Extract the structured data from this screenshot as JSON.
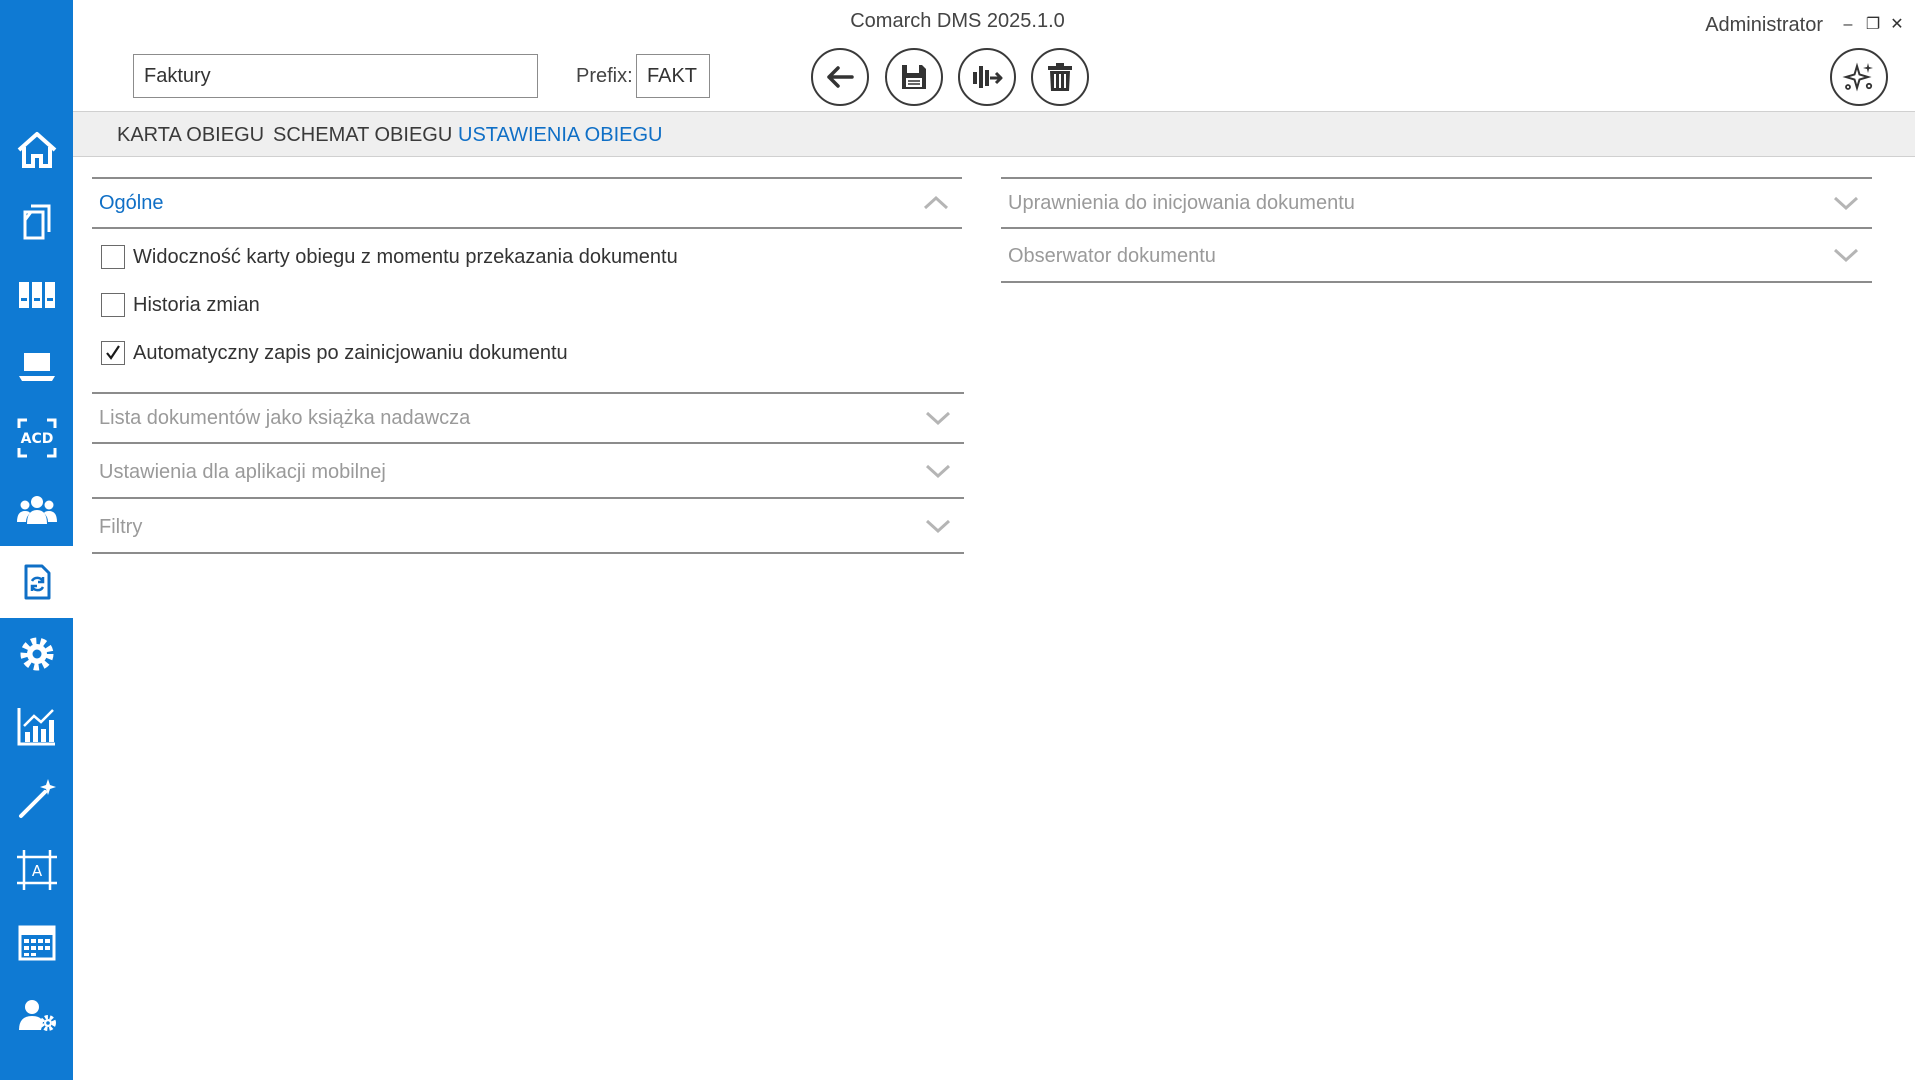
{
  "app": {
    "title": "Comarch DMS 2025.1.0",
    "user": "Administrator"
  },
  "window": {
    "minimize": "–",
    "restore": "❐",
    "close": "✕"
  },
  "header": {
    "name_value": "Faktury",
    "prefix_label": "Prefix:",
    "prefix_value": "FAKT"
  },
  "toolbar": {
    "icons": [
      "back-icon",
      "save-icon",
      "export-icon",
      "delete-icon",
      "ai-assistant-icon"
    ]
  },
  "sidebar": {
    "items": [
      {
        "icon": "home-icon",
        "active": false
      },
      {
        "icon": "documents-icon",
        "active": false
      },
      {
        "icon": "binders-icon",
        "active": false
      },
      {
        "icon": "laptop-icon",
        "active": false
      },
      {
        "icon": "acd-icon",
        "active": false
      },
      {
        "icon": "users-icon",
        "active": false
      },
      {
        "icon": "document-flow-icon",
        "active": true
      },
      {
        "icon": "settings-icon",
        "active": false
      },
      {
        "icon": "reports-icon",
        "active": false
      },
      {
        "icon": "magic-wand-icon",
        "active": false
      },
      {
        "icon": "designer-icon",
        "active": false
      },
      {
        "icon": "calendar-icon",
        "active": false
      },
      {
        "icon": "user-settings-icon",
        "active": false
      }
    ]
  },
  "tabs": [
    {
      "label": "KARTA OBIEGU",
      "active": false
    },
    {
      "label": "SCHEMAT OBIEGU",
      "active": false
    },
    {
      "label": "USTAWIENIA OBIEGU",
      "active": true
    }
  ],
  "left_panel": {
    "general": {
      "title": "Ogólne",
      "options": [
        {
          "label": "Widoczność karty obiegu z momentu przekazania dokumentu",
          "checked": false
        },
        {
          "label": "Historia zmian",
          "checked": false
        },
        {
          "label": "Automatyczny zapis po zainicjowaniu dokumentu",
          "checked": true
        }
      ]
    },
    "collapsed_sections": [
      "Lista dokumentów jako książka nadawcza",
      "Ustawienia dla aplikacji mobilnej",
      "Filtry"
    ]
  },
  "right_panel": {
    "collapsed_sections": [
      "Uprawnienia do inicjowania dokumentu",
      "Obserwator dokumentu"
    ]
  },
  "colors": {
    "sidebar": "#0f7ad3",
    "accent": "#0f6fc6",
    "muted_text": "#9a9a9a"
  }
}
